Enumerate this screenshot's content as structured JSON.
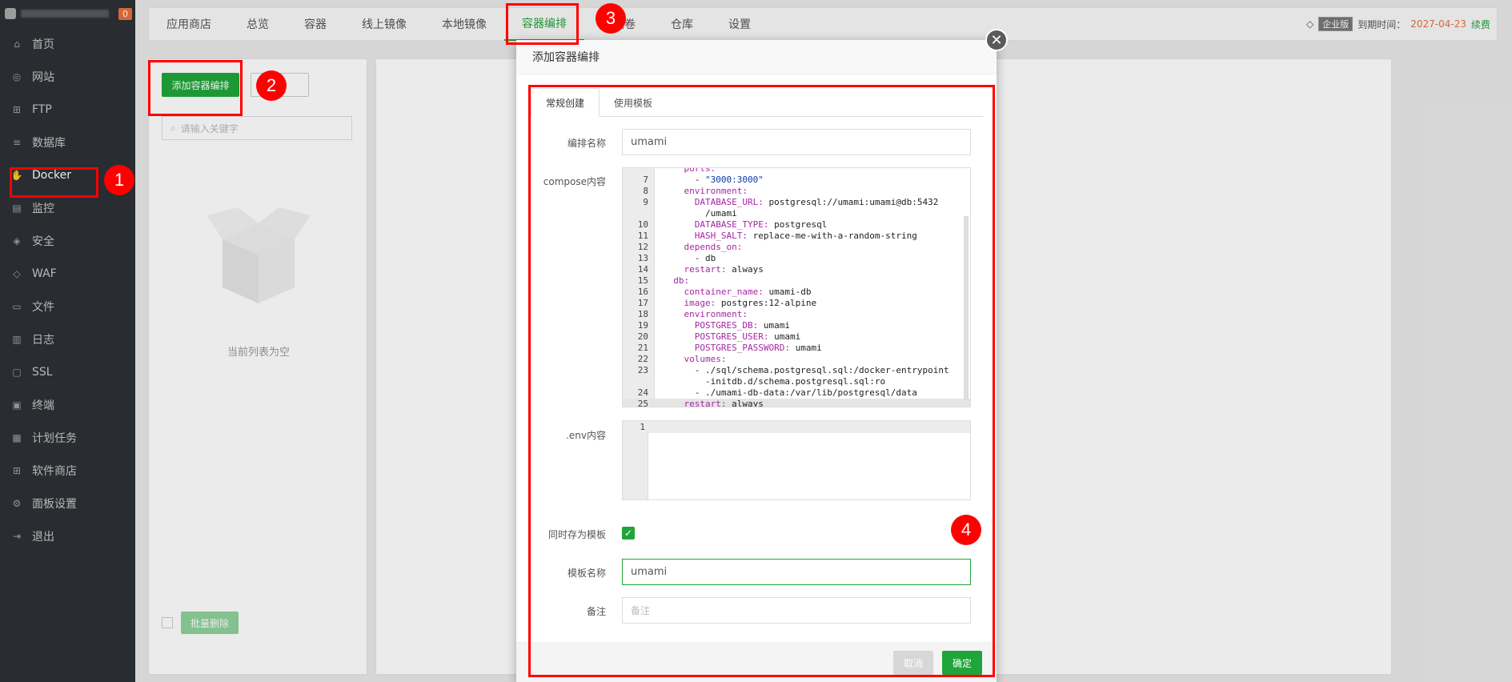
{
  "sidebar": {
    "badge": "0",
    "items": [
      {
        "label": "首页",
        "icon": "home-icon",
        "glyph": "⌂"
      },
      {
        "label": "网站",
        "icon": "globe-icon",
        "glyph": "◎"
      },
      {
        "label": "FTP",
        "icon": "ftp-icon",
        "glyph": "⊞"
      },
      {
        "label": "数据库",
        "icon": "database-icon",
        "glyph": "≡"
      },
      {
        "label": "Docker",
        "icon": "docker-icon",
        "glyph": "✋"
      },
      {
        "label": "监控",
        "icon": "monitor-icon",
        "glyph": "▤"
      },
      {
        "label": "安全",
        "icon": "shield-icon",
        "glyph": "◈"
      },
      {
        "label": "WAF",
        "icon": "waf-icon",
        "glyph": "◇"
      },
      {
        "label": "文件",
        "icon": "folder-icon",
        "glyph": "▭"
      },
      {
        "label": "日志",
        "icon": "log-icon",
        "glyph": "▥"
      },
      {
        "label": "SSL",
        "icon": "ssl-icon",
        "glyph": "▢"
      },
      {
        "label": "终端",
        "icon": "terminal-icon",
        "glyph": "▣"
      },
      {
        "label": "计划任务",
        "icon": "calendar-icon",
        "glyph": "▦"
      },
      {
        "label": "软件商店",
        "icon": "apps-icon",
        "glyph": "⊞"
      },
      {
        "label": "面板设置",
        "icon": "gear-icon",
        "glyph": "⚙"
      },
      {
        "label": "退出",
        "icon": "logout-icon",
        "glyph": "⇥"
      }
    ]
  },
  "topbar": {
    "tabs": [
      "应用商店",
      "总览",
      "容器",
      "线上镜像",
      "本地镜像",
      "容器编排",
      "存储卷",
      "仓库",
      "设置"
    ],
    "edition": "企业版",
    "expire_label": "到期时间：",
    "expire_date": "2027-04-23",
    "renew": "续费"
  },
  "left": {
    "add_button": "添加容器编排",
    "template_button": "板",
    "search_placeholder": "请输入关键字",
    "empty_text": "当前列表为空",
    "batch_delete": "批量删除"
  },
  "modal": {
    "title": "添加容器编排",
    "tabs": [
      "常规创建",
      "使用模板"
    ],
    "name_label": "编排名称",
    "name_value": "umami",
    "compose_label": "compose内容",
    "env_label": ".env内容",
    "save_template_label": "同时存为模板",
    "template_name_label": "模板名称",
    "template_name_value": "umami",
    "remark_label": "备注",
    "remark_placeholder": "备注",
    "cancel": "取消",
    "ok": "确定",
    "code_lines": [
      {
        "n": "",
        "t": "    ports:"
      },
      {
        "n": "7",
        "t": "      - \"3000:3000\""
      },
      {
        "n": "8",
        "t": "    environment:"
      },
      {
        "n": "9",
        "t": "      DATABASE_URL: postgresql://umami:umami@db:5432"
      },
      {
        "n": "",
        "t": "        /umami"
      },
      {
        "n": "10",
        "t": "      DATABASE_TYPE: postgresql"
      },
      {
        "n": "11",
        "t": "      HASH_SALT: replace-me-with-a-random-string"
      },
      {
        "n": "12",
        "t": "    depends_on:"
      },
      {
        "n": "13",
        "t": "      - db"
      },
      {
        "n": "14",
        "t": "    restart: always"
      },
      {
        "n": "15",
        "t": "  db:"
      },
      {
        "n": "16",
        "t": "    container_name: umami-db"
      },
      {
        "n": "17",
        "t": "    image: postgres:12-alpine"
      },
      {
        "n": "18",
        "t": "    environment:"
      },
      {
        "n": "19",
        "t": "      POSTGRES_DB: umami"
      },
      {
        "n": "20",
        "t": "      POSTGRES_USER: umami"
      },
      {
        "n": "21",
        "t": "      POSTGRES_PASSWORD: umami"
      },
      {
        "n": "22",
        "t": "    volumes:"
      },
      {
        "n": "23",
        "t": "      - ./sql/schema.postgresql.sql:/docker-entrypoint"
      },
      {
        "n": "",
        "t": "        -initdb.d/schema.postgresql.sql:ro"
      },
      {
        "n": "24",
        "t": "      - ./umami-db-data:/var/lib/postgresql/data"
      },
      {
        "n": "25",
        "t": "    restart: always"
      }
    ],
    "env_line": "1"
  },
  "annotations": [
    "1",
    "2",
    "3",
    "4"
  ],
  "colors": {
    "accent": "#20a53a",
    "annotation": "#ff0000"
  }
}
